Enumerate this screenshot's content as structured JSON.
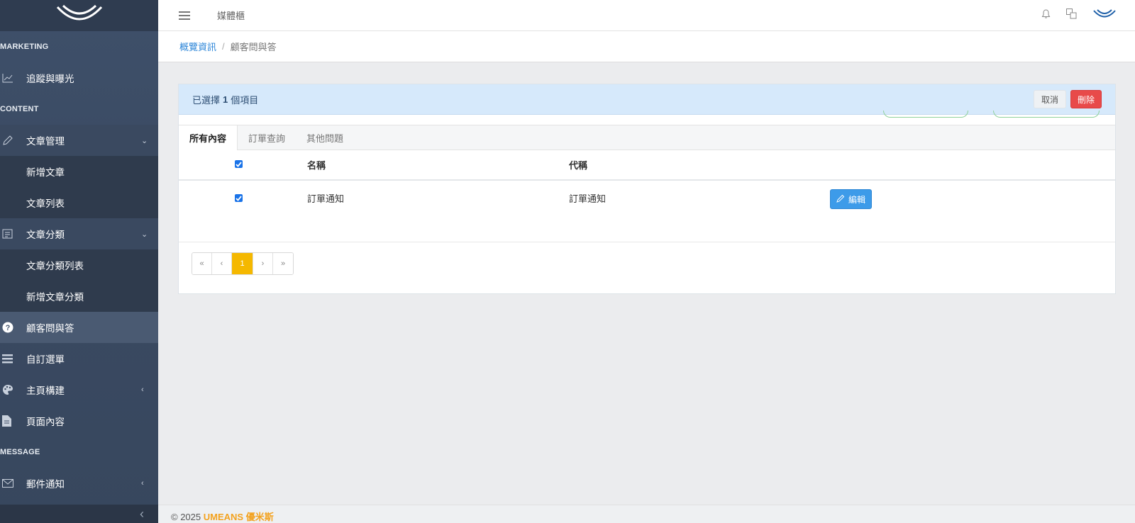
{
  "sidebar": {
    "sections": {
      "marketing": "MARKETING",
      "content": "CONTENT",
      "message": "MESSAGE"
    },
    "items": {
      "tracking": "追蹤與曝光",
      "articles": "文章管理",
      "add_article": "新增文章",
      "article_list": "文章列表",
      "categories": "文章分類",
      "category_list": "文章分類列表",
      "add_category": "新增文章分類",
      "faq": "顧客問與答",
      "custom_menu": "自訂選單",
      "homepage_builder": "主頁構建",
      "page_content": "頁面內容",
      "mail_notify": "郵件通知"
    }
  },
  "header": {
    "title": "媒體櫃"
  },
  "breadcrumb": {
    "home": "概覽資訊",
    "separator": "/",
    "current": "顧客問與答"
  },
  "selection": {
    "prefix": "已選擇",
    "count": "1",
    "suffix": "個項目",
    "cancel": "取消",
    "delete": "刪除"
  },
  "tabs": [
    "所有內容",
    "訂單查詢",
    "其他問題"
  ],
  "table": {
    "columns": {
      "name": "名稱",
      "code": "代稱"
    },
    "rows": [
      {
        "name": "訂單通知",
        "code": "訂單通知",
        "edit": "編輯",
        "checked": true
      }
    ]
  },
  "pagination": {
    "first": "«",
    "prev": "‹",
    "current": "1",
    "next": "›",
    "last": "»"
  },
  "footer": {
    "copyright": "© 2025",
    "brand": "UMEANS 優米斯"
  },
  "colors": {
    "sidebar": "#3b4a62",
    "accent": "#2b85d8",
    "danger": "#e84a4a",
    "pager_active": "#f5b800",
    "brand": "#f3a21f"
  }
}
